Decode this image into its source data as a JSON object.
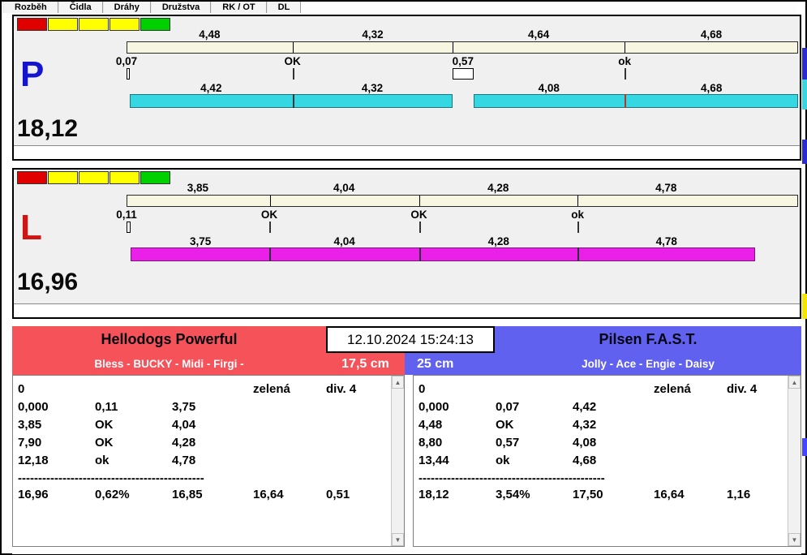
{
  "tabs": [
    "Rozběh",
    "Čidla",
    "Dráhy",
    "Družstva",
    "RK / OT",
    "DL"
  ],
  "lights": [
    "#e10000",
    "#ffff00",
    "#ffff00",
    "#ffff00",
    "#00cf00"
  ],
  "lane_p": {
    "label": "P",
    "letter_color": "#1515cf",
    "bar_color": "#35d8e2",
    "total": "18,12",
    "plan_splits": [
      "4,48",
      "4,32",
      "4,64",
      "4,68"
    ],
    "changeovers": [
      "0,07",
      "OK",
      "0,57",
      "ok"
    ],
    "run_splits": [
      "4,42",
      "4,32",
      "4,08",
      "4,68"
    ]
  },
  "lane_l": {
    "label": "L",
    "letter_color": "#d01515",
    "bar_color": "#ea1fe8",
    "total": "16,96",
    "plan_splits": [
      "3,85",
      "4,04",
      "4,28",
      "4,78"
    ],
    "changeovers": [
      "0,11",
      "OK",
      "OK",
      "ok"
    ],
    "run_splits": [
      "3,75",
      "4,04",
      "4,28",
      "4,78"
    ]
  },
  "board": {
    "datetime": "12.10.2024 15:24:13",
    "team_left": {
      "name": "Hellodogs Powerful",
      "dogs": "Bless - BUCKY - Midi - Firgi -",
      "jump_height": "17,5 cm",
      "color": "#f5525a"
    },
    "team_right": {
      "name": "Pilsen F.A.S.T.",
      "dogs": "Jolly - Ace - Engie - Daisy",
      "jump_height": "25 cm",
      "color": "#6161ef"
    },
    "left_log": {
      "header": {
        "c1": "0",
        "c4": "zelená",
        "c5": "div. 4"
      },
      "rows": [
        [
          "0,000",
          "0,11",
          "3,75"
        ],
        [
          "3,85",
          "OK",
          "4,04"
        ],
        [
          "7,90",
          "OK",
          "4,28"
        ],
        [
          "12,18",
          "ok",
          "4,78"
        ]
      ],
      "separator": "----------------------------------------------",
      "totals": [
        "16,96",
        "0,62%",
        "16,85",
        "16,64",
        "0,51"
      ]
    },
    "right_log": {
      "header": {
        "c1": "0",
        "c4": "zelená",
        "c5": "div. 4"
      },
      "rows": [
        [
          "0,000",
          "0,07",
          "4,42"
        ],
        [
          "4,48",
          "OK",
          "4,32"
        ],
        [
          "8,80",
          "0,57",
          "4,08"
        ],
        [
          "13,44",
          "ok",
          "4,68"
        ]
      ],
      "separator": "----------------------------------------------",
      "totals": [
        "18,12",
        "3,54%",
        "17,50",
        "16,64",
        "1,16"
      ]
    }
  },
  "scroll": {
    "up": "▲",
    "down": "▼"
  }
}
